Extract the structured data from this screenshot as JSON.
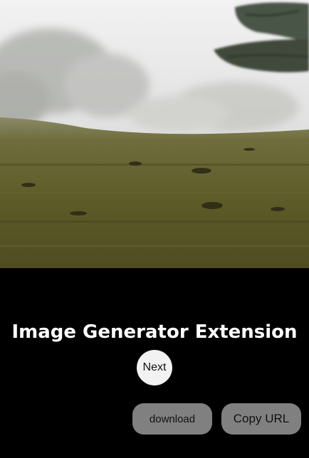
{
  "image": {
    "description_icon": "foggy-meadow-photo",
    "colors": {
      "fog": "#d9d9d9",
      "grass": "#5e5a28",
      "pine": "#3f4a3a"
    }
  },
  "title": "Image Generator Extension",
  "buttons": {
    "next_label": "Next",
    "download_label": "download",
    "copy_url_label": "Copy URL"
  },
  "colors": {
    "background": "#000000",
    "title_text": "#ffffff",
    "next_button_bg": "#f2f2f2",
    "action_button_bg": "#808080"
  }
}
